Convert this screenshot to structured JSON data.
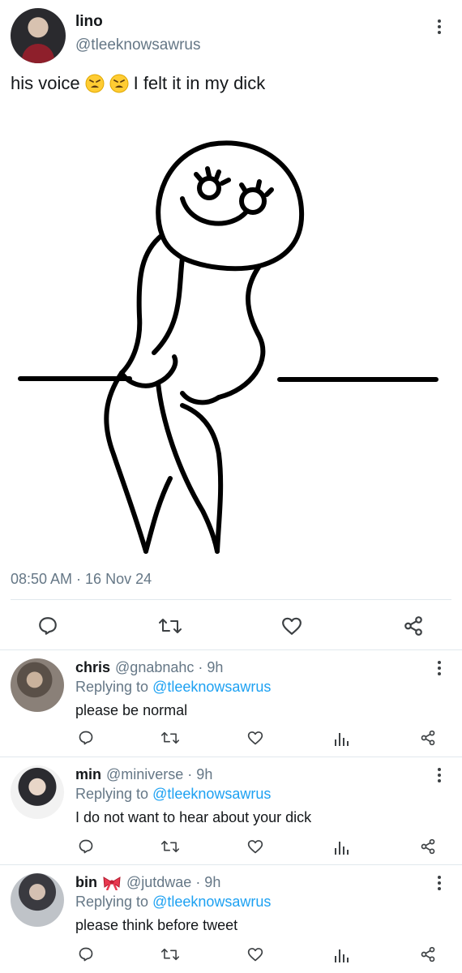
{
  "tweet": {
    "author_name": "lino",
    "author_handle": "@tleeknowsawrus",
    "text_before": "his voice",
    "text_after": "I felt it in my dick",
    "emojis": [
      "weary-face",
      "weary-face"
    ],
    "timestamp": "08:50 AM · 16 Nov 24"
  },
  "actions": {
    "icons": [
      "reply-icon",
      "retweet-icon",
      "like-icon",
      "share-icon"
    ]
  },
  "replies": [
    {
      "name": "chris",
      "handle": "@gnabnahc · 9h",
      "replying_label": "Replying to",
      "replying_to": "@tleeknowsawrus",
      "text": "please be normal"
    },
    {
      "name": "min",
      "handle": "@miniverse · 9h",
      "replying_label": "Replying to",
      "replying_to": "@tleeknowsawrus",
      "text": "I do not want to hear about your dick"
    },
    {
      "name": "bin",
      "name_badge": "ribbon-emoji",
      "handle": "@jutdwae · 9h",
      "replying_label": "Replying to",
      "replying_to": "@tleeknowsawrus",
      "text": "please think before tweet"
    }
  ],
  "colors": {
    "text": "#14171a",
    "secondary": "#657786",
    "mention": "#1da1f2",
    "divider": "#e1e8ed"
  }
}
